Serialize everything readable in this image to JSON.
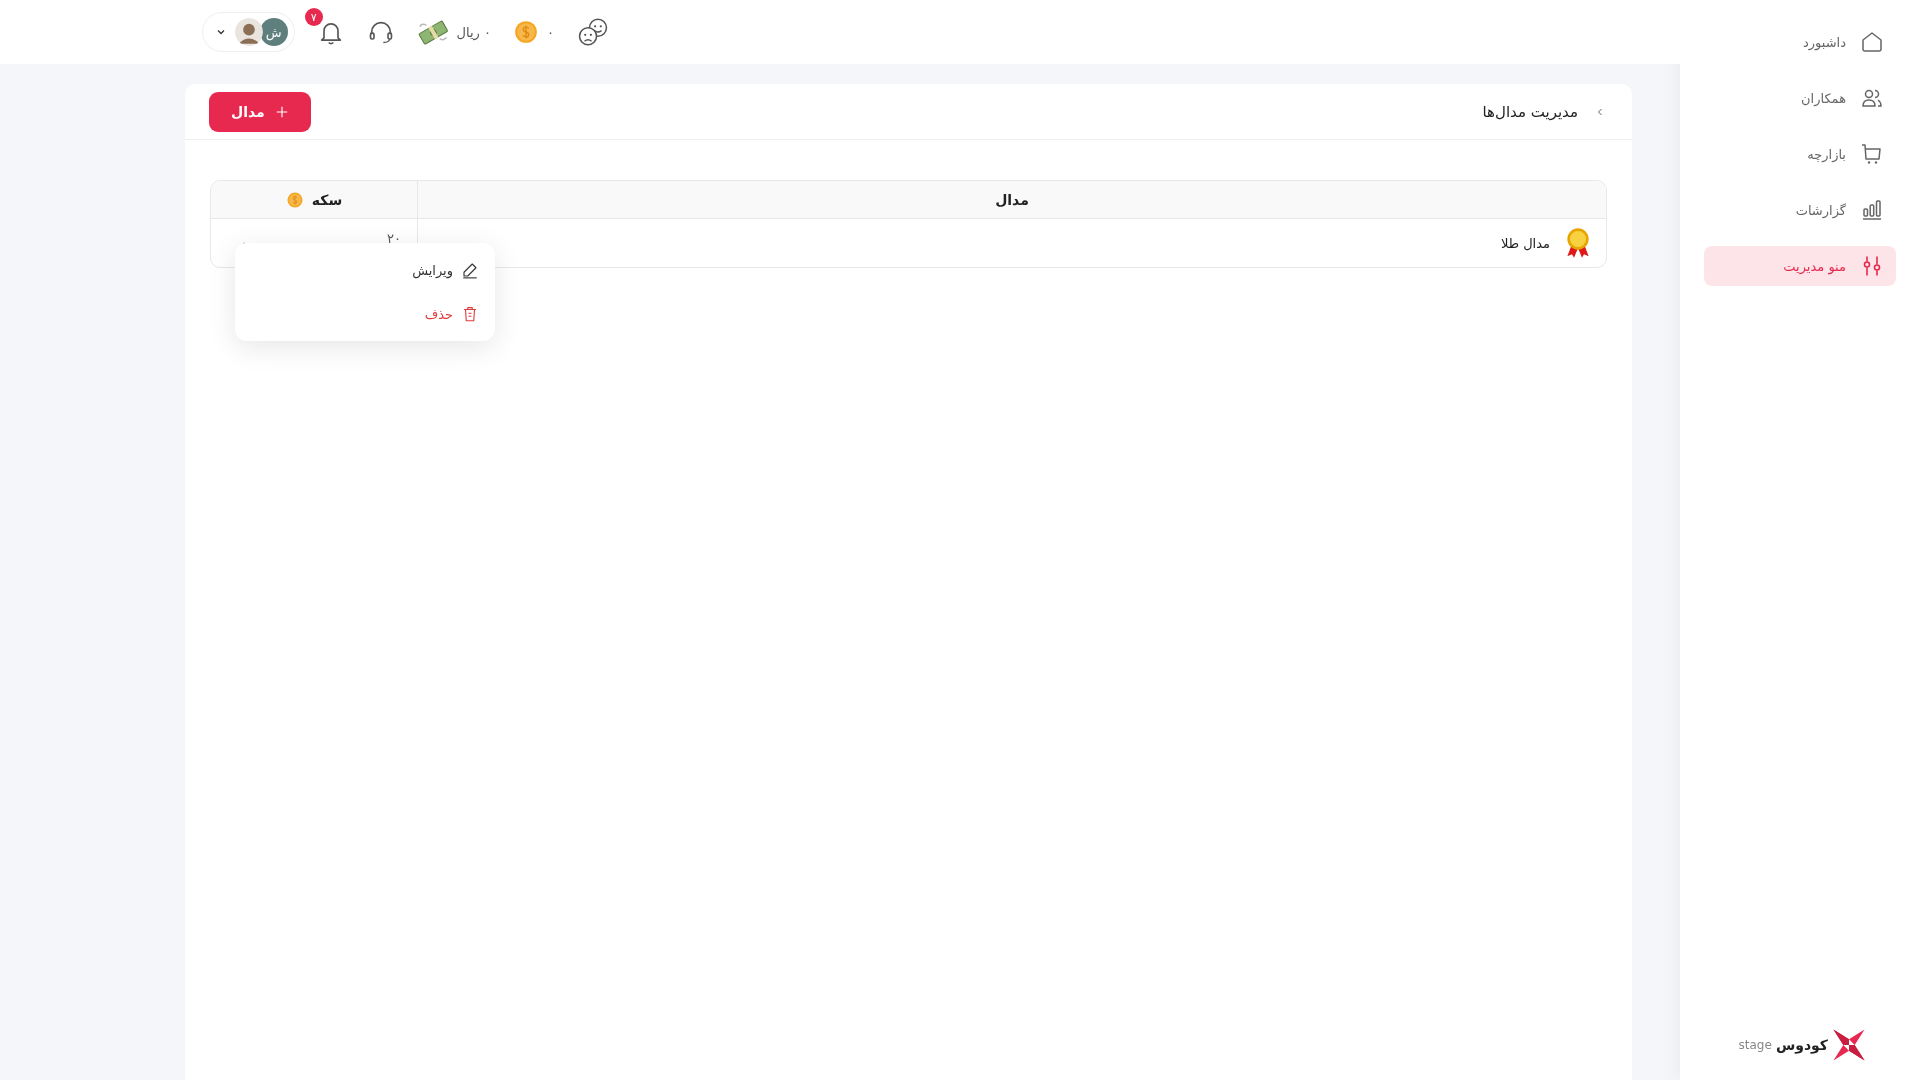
{
  "sidebar": {
    "items": [
      {
        "label": "داشبورد",
        "kind": "home",
        "selected": false
      },
      {
        "label": "همکاران",
        "kind": "users",
        "selected": false
      },
      {
        "label": "بازارچه",
        "kind": "cart",
        "selected": false
      },
      {
        "label": "گزارشات",
        "kind": "chart",
        "selected": false
      },
      {
        "label": "منو مدیریت",
        "kind": "sliders",
        "selected": true
      }
    ],
    "brand": {
      "name": "کودوس",
      "env": "stage"
    }
  },
  "topbar": {
    "coins": "۰",
    "balance": "۰ ریال",
    "notifications": "۷",
    "user_initial": "ش"
  },
  "page": {
    "title": "مدیریت مدال‌ها",
    "add_button": "مدال"
  },
  "table": {
    "columns": [
      "مدال",
      "سکه"
    ],
    "rows": [
      {
        "medal": "مدال طلا",
        "coins": "۲۰"
      }
    ]
  },
  "row_menu": {
    "items": [
      {
        "label": "ویرایش",
        "kind": "edit"
      },
      {
        "label": "حذف",
        "kind": "delete"
      }
    ]
  }
}
